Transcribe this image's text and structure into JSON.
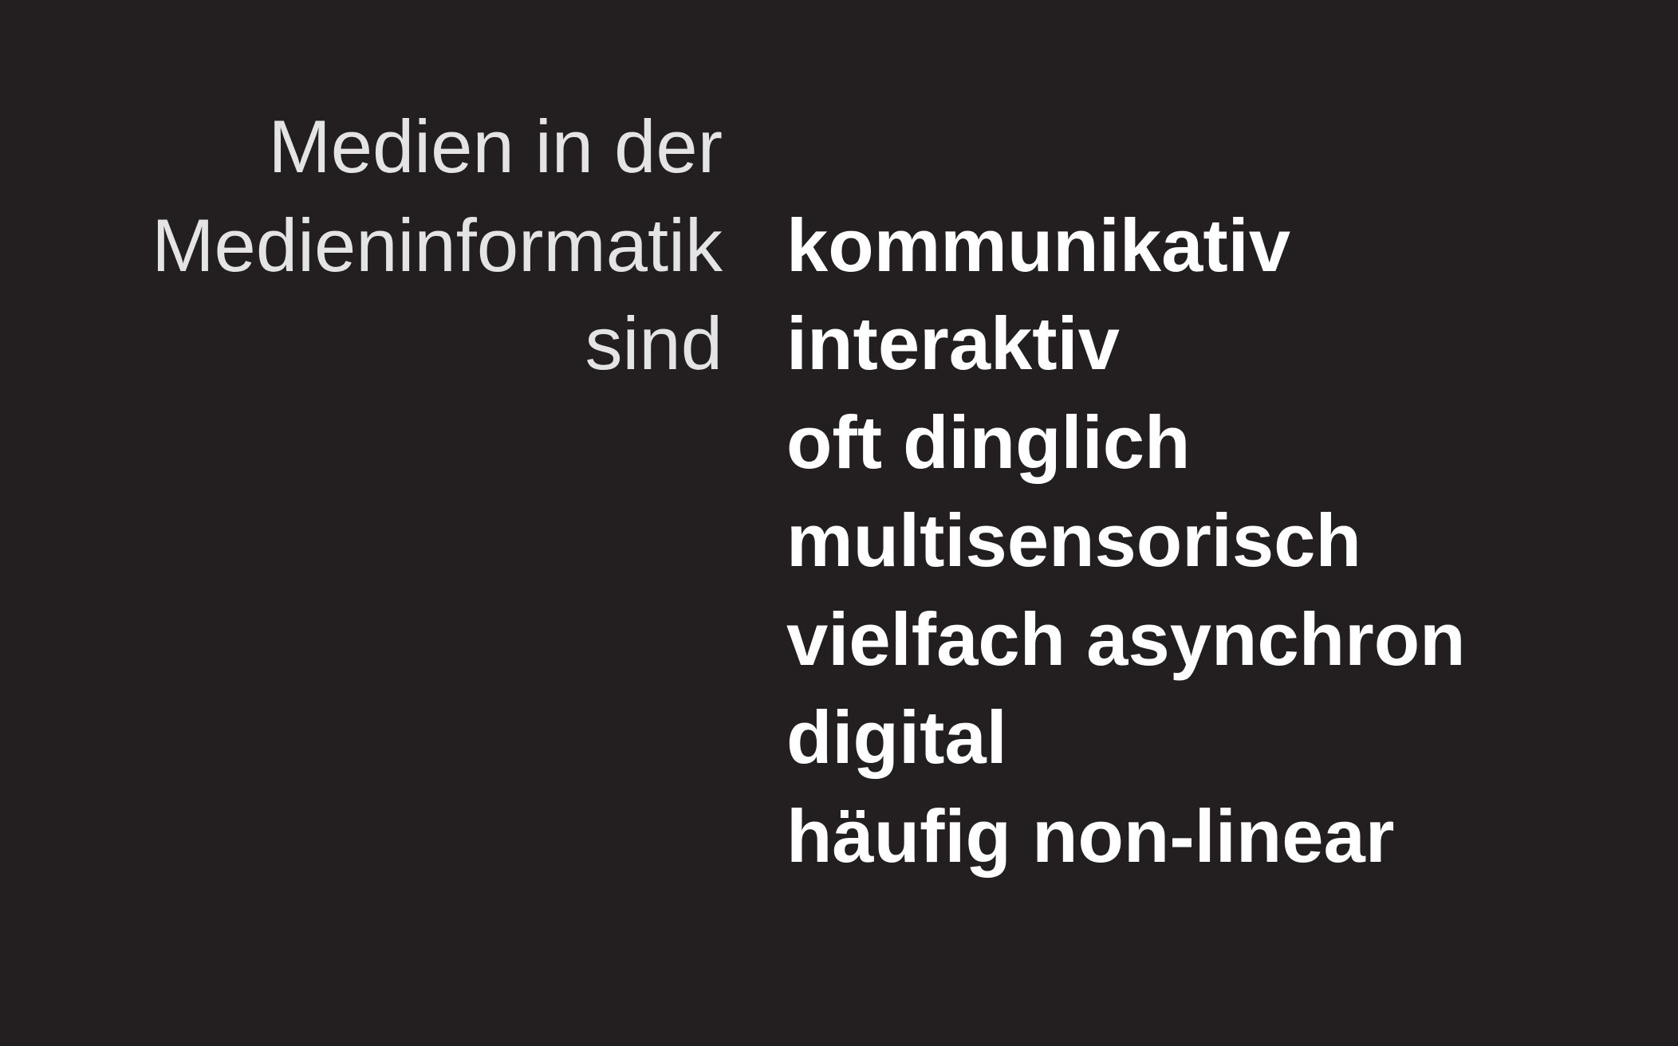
{
  "intro": {
    "lines": [
      "Medien in der",
      "Medieninformatik",
      "sind"
    ]
  },
  "attributes": {
    "items": [
      "kommunikativ",
      "interaktiv",
      "oft dinglich",
      "multisensorisch",
      "vielfach asynchron",
      "digital",
      "häufig non-linear"
    ]
  },
  "colors": {
    "background": "#231f20",
    "intro_text": "#e4e4e4",
    "attribute_text": "#ffffff"
  }
}
